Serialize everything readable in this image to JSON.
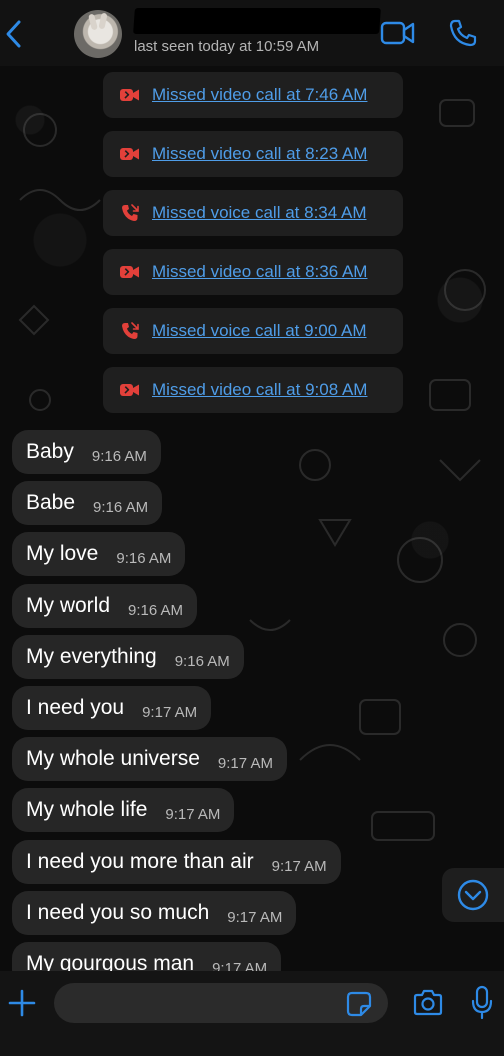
{
  "header": {
    "last_seen": "last seen today at 10:59 AM",
    "icons": {
      "back": "chevron-left-icon",
      "video": "video-camera-icon",
      "voice": "phone-icon"
    }
  },
  "call_log": [
    {
      "type": "video",
      "text": "Missed video call at 7:46 AM"
    },
    {
      "type": "video",
      "text": "Missed video call at 8:23 AM"
    },
    {
      "type": "voice",
      "text": "Missed voice call at 8:34 AM"
    },
    {
      "type": "video",
      "text": "Missed video call at 8:36 AM"
    },
    {
      "type": "voice",
      "text": "Missed voice call at 9:00 AM"
    },
    {
      "type": "video",
      "text": "Missed video call at 9:08 AM"
    }
  ],
  "messages": [
    {
      "text": "Baby",
      "time": "9:16 AM"
    },
    {
      "text": "Babe",
      "time": "9:16 AM"
    },
    {
      "text": "My love",
      "time": "9:16 AM"
    },
    {
      "text": "My world",
      "time": "9:16 AM"
    },
    {
      "text": "My everything",
      "time": "9:16 AM"
    },
    {
      "text": "I need you",
      "time": "9:17 AM"
    },
    {
      "text": "My whole universe",
      "time": "9:17 AM"
    },
    {
      "text": "My whole life",
      "time": "9:17 AM"
    },
    {
      "text": "I need you more than air",
      "time": "9:17 AM"
    },
    {
      "text": "I need you so much",
      "time": "9:17 AM"
    },
    {
      "text": "My gourgous man",
      "time": "9:17 AM"
    }
  ],
  "composer": {
    "input_value": "",
    "icons": {
      "plus": "plus-icon",
      "sticker": "sticker-icon",
      "camera": "camera-icon",
      "mic": "microphone-icon"
    }
  },
  "colors": {
    "accent": "#2e8ae6",
    "link": "#4f9de8",
    "missed": "#e2403a",
    "bubble": "#262626"
  }
}
